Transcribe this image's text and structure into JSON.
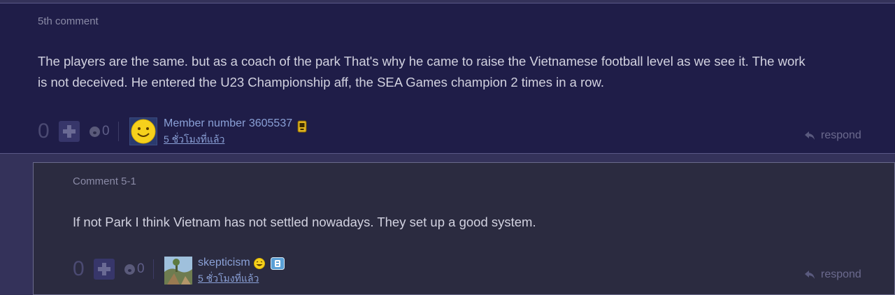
{
  "comment": {
    "label": "5th comment",
    "text_line1": "The players are the same. but as a coach of the park That's why he came to raise the Vietnamese football level as we see it. The work",
    "text_line2": "is not deceived. He entered the U23 Championship aff, the SEA Games champion 2 times in a row.",
    "score": "0",
    "emotion_count": "0",
    "user_name": "Member number 3605537",
    "time": "5 ชั่วโมงที่แล้ว",
    "respond_label": "respond"
  },
  "reply": {
    "label": "Comment 5-1",
    "text": "If not Park I think Vietnam has not settled nowadays. They set up a good system.",
    "score": "0",
    "emotion_count": "0",
    "user_name": "skepticism",
    "time": "5 ชั่วโมงที่แล้ว",
    "respond_label": "respond"
  },
  "colors": {
    "page_bg": "#34325a",
    "comment_bg": "#1f1d48",
    "reply_bg": "#2b2b40",
    "text": "#d2d2e0",
    "link": "#8aa0d6",
    "muted": "#8a8aa6"
  }
}
